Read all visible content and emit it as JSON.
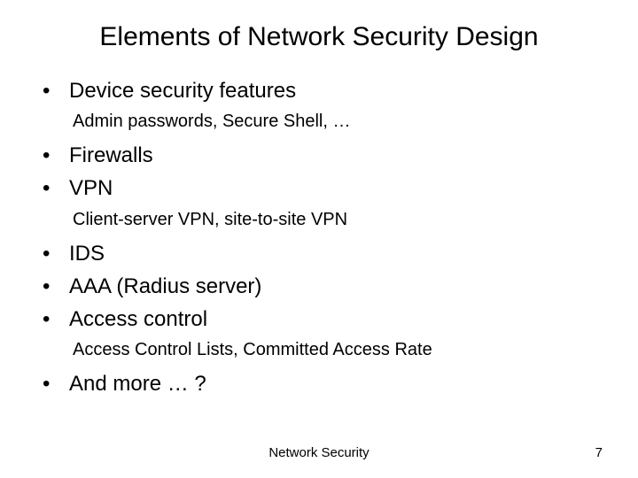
{
  "title": "Elements of Network Security Design",
  "items": {
    "b0": "Device security features",
    "s0": "Admin passwords, Secure Shell, …",
    "b1": "Firewalls",
    "b2": "VPN",
    "s1": "Client-server VPN, site-to-site VPN",
    "b3": "IDS",
    "b4": "AAA (Radius server)",
    "b5": "Access control",
    "s2": "Access Control Lists, Committed Access Rate",
    "b6": "And more … ?"
  },
  "bullet": "•",
  "footer": {
    "center": "Network Security",
    "page": "7"
  }
}
